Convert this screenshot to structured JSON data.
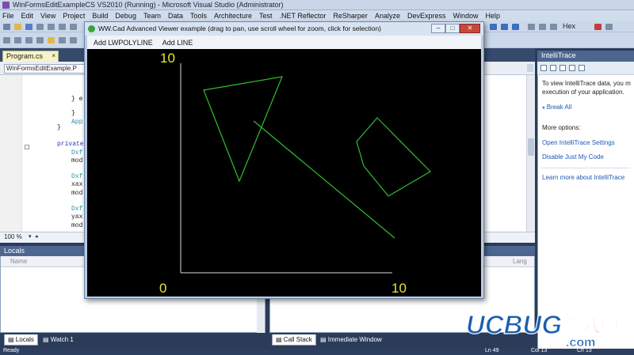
{
  "vs": {
    "title": "WinFormsEditExampleCS VS2010 (Running) - Microsoft Visual Studio (Administrator)",
    "menu": [
      "File",
      "Edit",
      "View",
      "Project",
      "Build",
      "Debug",
      "Team",
      "Data",
      "Tools",
      "Architecture",
      "Test",
      ".NET Reflector",
      "ReSharper",
      "Analyze",
      "DevExpress",
      "Window",
      "Help"
    ],
    "toolbar_hex": "Hex",
    "doc_tab": "Program.cs",
    "nav_combo": "WinFormsEditExample.P",
    "code_lines": [
      "} e",
      "}",
      "App",
      "}",
      "private",
      "Dxf",
      "mod",
      "Dxf",
      "xax",
      "mod",
      "Dxf",
      "yax",
      "mod"
    ],
    "zoom": "100 %",
    "status_ready": "Ready",
    "status_ln": "Ln 49",
    "status_col": "Col 13",
    "status_ch": "Ch 13"
  },
  "intellitrace": {
    "title": "IntelliTrace",
    "intro": [
      "To view IntelliTrace data, you m",
      "execution of your application."
    ],
    "break_all": "Break All",
    "more_options": "More options:",
    "open_settings": "Open IntelliTrace Settings",
    "disable_jmc": "Disable Just My Code",
    "learn_more": "Learn more about IntelliTrace"
  },
  "locals": {
    "title": "Locals",
    "col_name": "Name",
    "col_lang": "Lang"
  },
  "bottom_tabs": {
    "locals": "Locals",
    "watch": "Watch 1",
    "callstack": "Call Stack",
    "immediate": "Immediate Window"
  },
  "cad": {
    "title": "WW.Cad Advanced Viewer example (drag to pan, use scroll wheel for zoom, click for selection)",
    "menu": [
      "Add LWPOLYLINE",
      "Add LINE"
    ],
    "axis_label_color": "#e6e636",
    "entity_color": "#2fbf2f",
    "axis_color": "#dcdcdc",
    "labels": {
      "y_max": "10",
      "x_min": "0",
      "x_max": "10"
    }
  },
  "watermark": {
    "brand": "UCBUG",
    "cn": "游戏网",
    "domain": ".com"
  },
  "colors": {
    "vs_chrome": "#2b3c59",
    "panel_title": "#4c6690",
    "watermark_blue": "#1a5fb4",
    "watermark_red": "#d42020"
  }
}
